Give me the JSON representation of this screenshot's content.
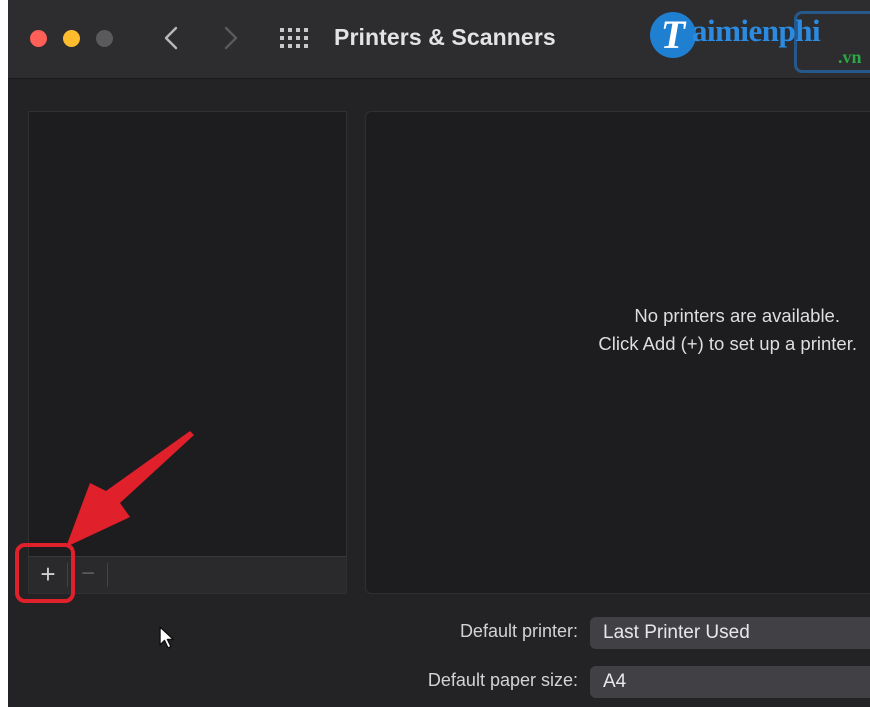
{
  "window": {
    "title": "Printers & Scanners"
  },
  "watermark": {
    "badge_letter": "T",
    "word": "aimienphi",
    "tld": ".vn"
  },
  "sidebar": {
    "add_label": "+",
    "remove_label": "−"
  },
  "main": {
    "empty_line1": "No printers are available.",
    "empty_line2": "Click Add (+) to set up a printer."
  },
  "settings": {
    "default_printer_label": "Default printer:",
    "default_printer_value": "Last Printer Used",
    "paper_size_label": "Default paper size:",
    "paper_size_value": "A4"
  },
  "colors": {
    "close": "#fe5f57",
    "minimize": "#febc2e",
    "zoom": "#5a5a5c",
    "annotation": "#e0202a"
  }
}
